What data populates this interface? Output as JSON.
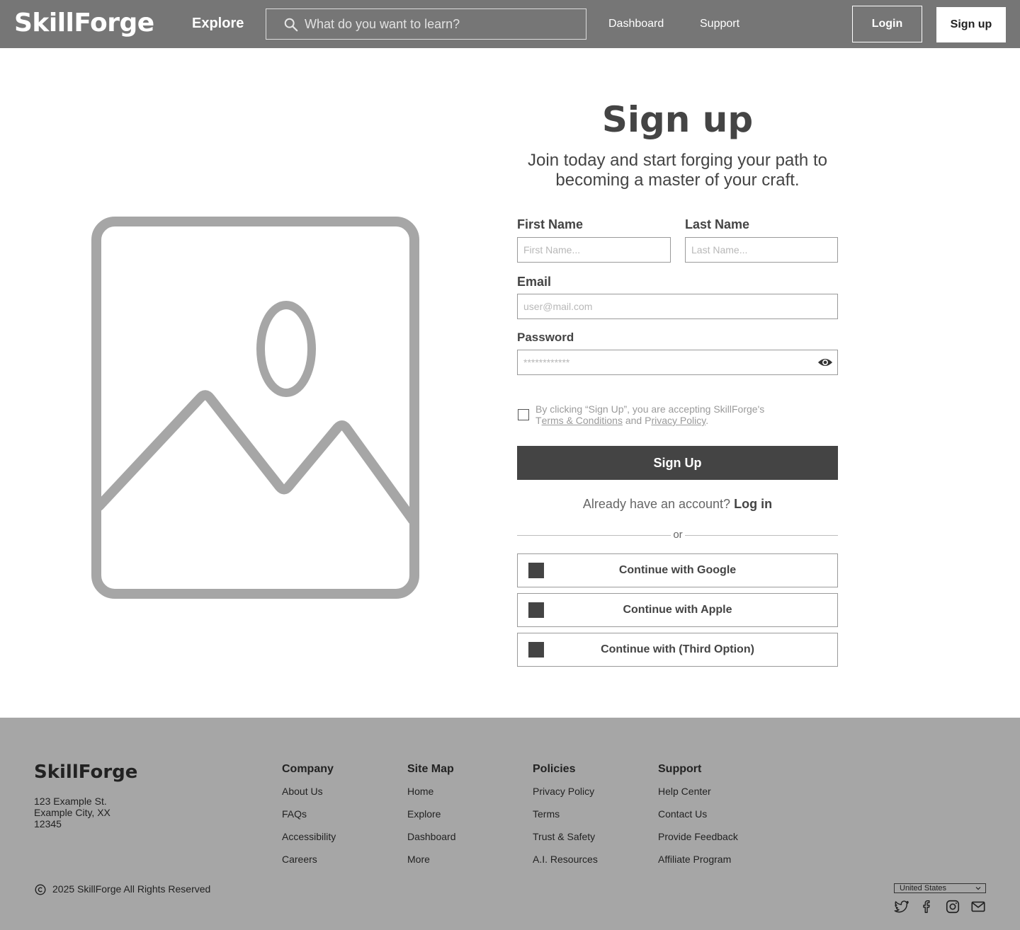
{
  "nav": {
    "logo": "SkillForge",
    "explore": "Explore",
    "search_placeholder": "What do you want to learn?",
    "links": [
      "Dashboard",
      "Support"
    ],
    "login": "Login",
    "signup": "Sign up"
  },
  "form": {
    "title": "Sign up",
    "subtitle": "Join today and start forging your path to becoming a master of your craft.",
    "first_name_label": "First Name",
    "first_name_placeholder": "First Name...",
    "last_name_label": "Last Name",
    "last_name_placeholder": "Last Name...",
    "email_label": "Email",
    "email_placeholder": "user@mail.com",
    "password_label": "Password",
    "password_placeholder": "************",
    "terms_prefix": "By clicking “Sign Up”, you are accepting SkillForge's T",
    "terms_link": "erms & Conditions",
    "terms_and": " and P",
    "privacy_link": "rivacy Policy",
    "terms_suffix": ".",
    "submit": "Sign Up",
    "already_text": "Already have an account?",
    "login_link": "Log in",
    "or": "or",
    "social": [
      {
        "label": "Continue with Google"
      },
      {
        "label": "Continue with Apple"
      },
      {
        "label": "Continue with (Third Option)"
      }
    ]
  },
  "footer": {
    "logo": "SkillForge",
    "address": [
      "123 Example St.",
      "Example City, XX",
      "12345"
    ],
    "columns": [
      {
        "title": "Company",
        "items": [
          "About Us",
          "FAQs",
          "Accessibility",
          "Careers"
        ]
      },
      {
        "title": "Site Map",
        "items": [
          "Home",
          "Explore",
          "Dashboard",
          "More"
        ]
      },
      {
        "title": "Policies",
        "items": [
          "Privacy Policy",
          "Terms",
          "Trust & Safety",
          "A.I. Resources"
        ]
      },
      {
        "title": "Support",
        "items": [
          "Help Center",
          "Contact Us",
          "Provide Feedback",
          "Affiliate Program"
        ]
      }
    ],
    "copyright": "2025 SkillForge All Rights Reserved",
    "country": "United States",
    "social_icons": [
      "twitter-icon",
      "facebook-icon",
      "instagram-icon",
      "mail-icon"
    ]
  },
  "colors": {
    "nav_bg": "#767676",
    "footer_bg": "#a6a6a6",
    "primary_button": "#444444",
    "placeholder_gray": "#a6a6a6"
  }
}
